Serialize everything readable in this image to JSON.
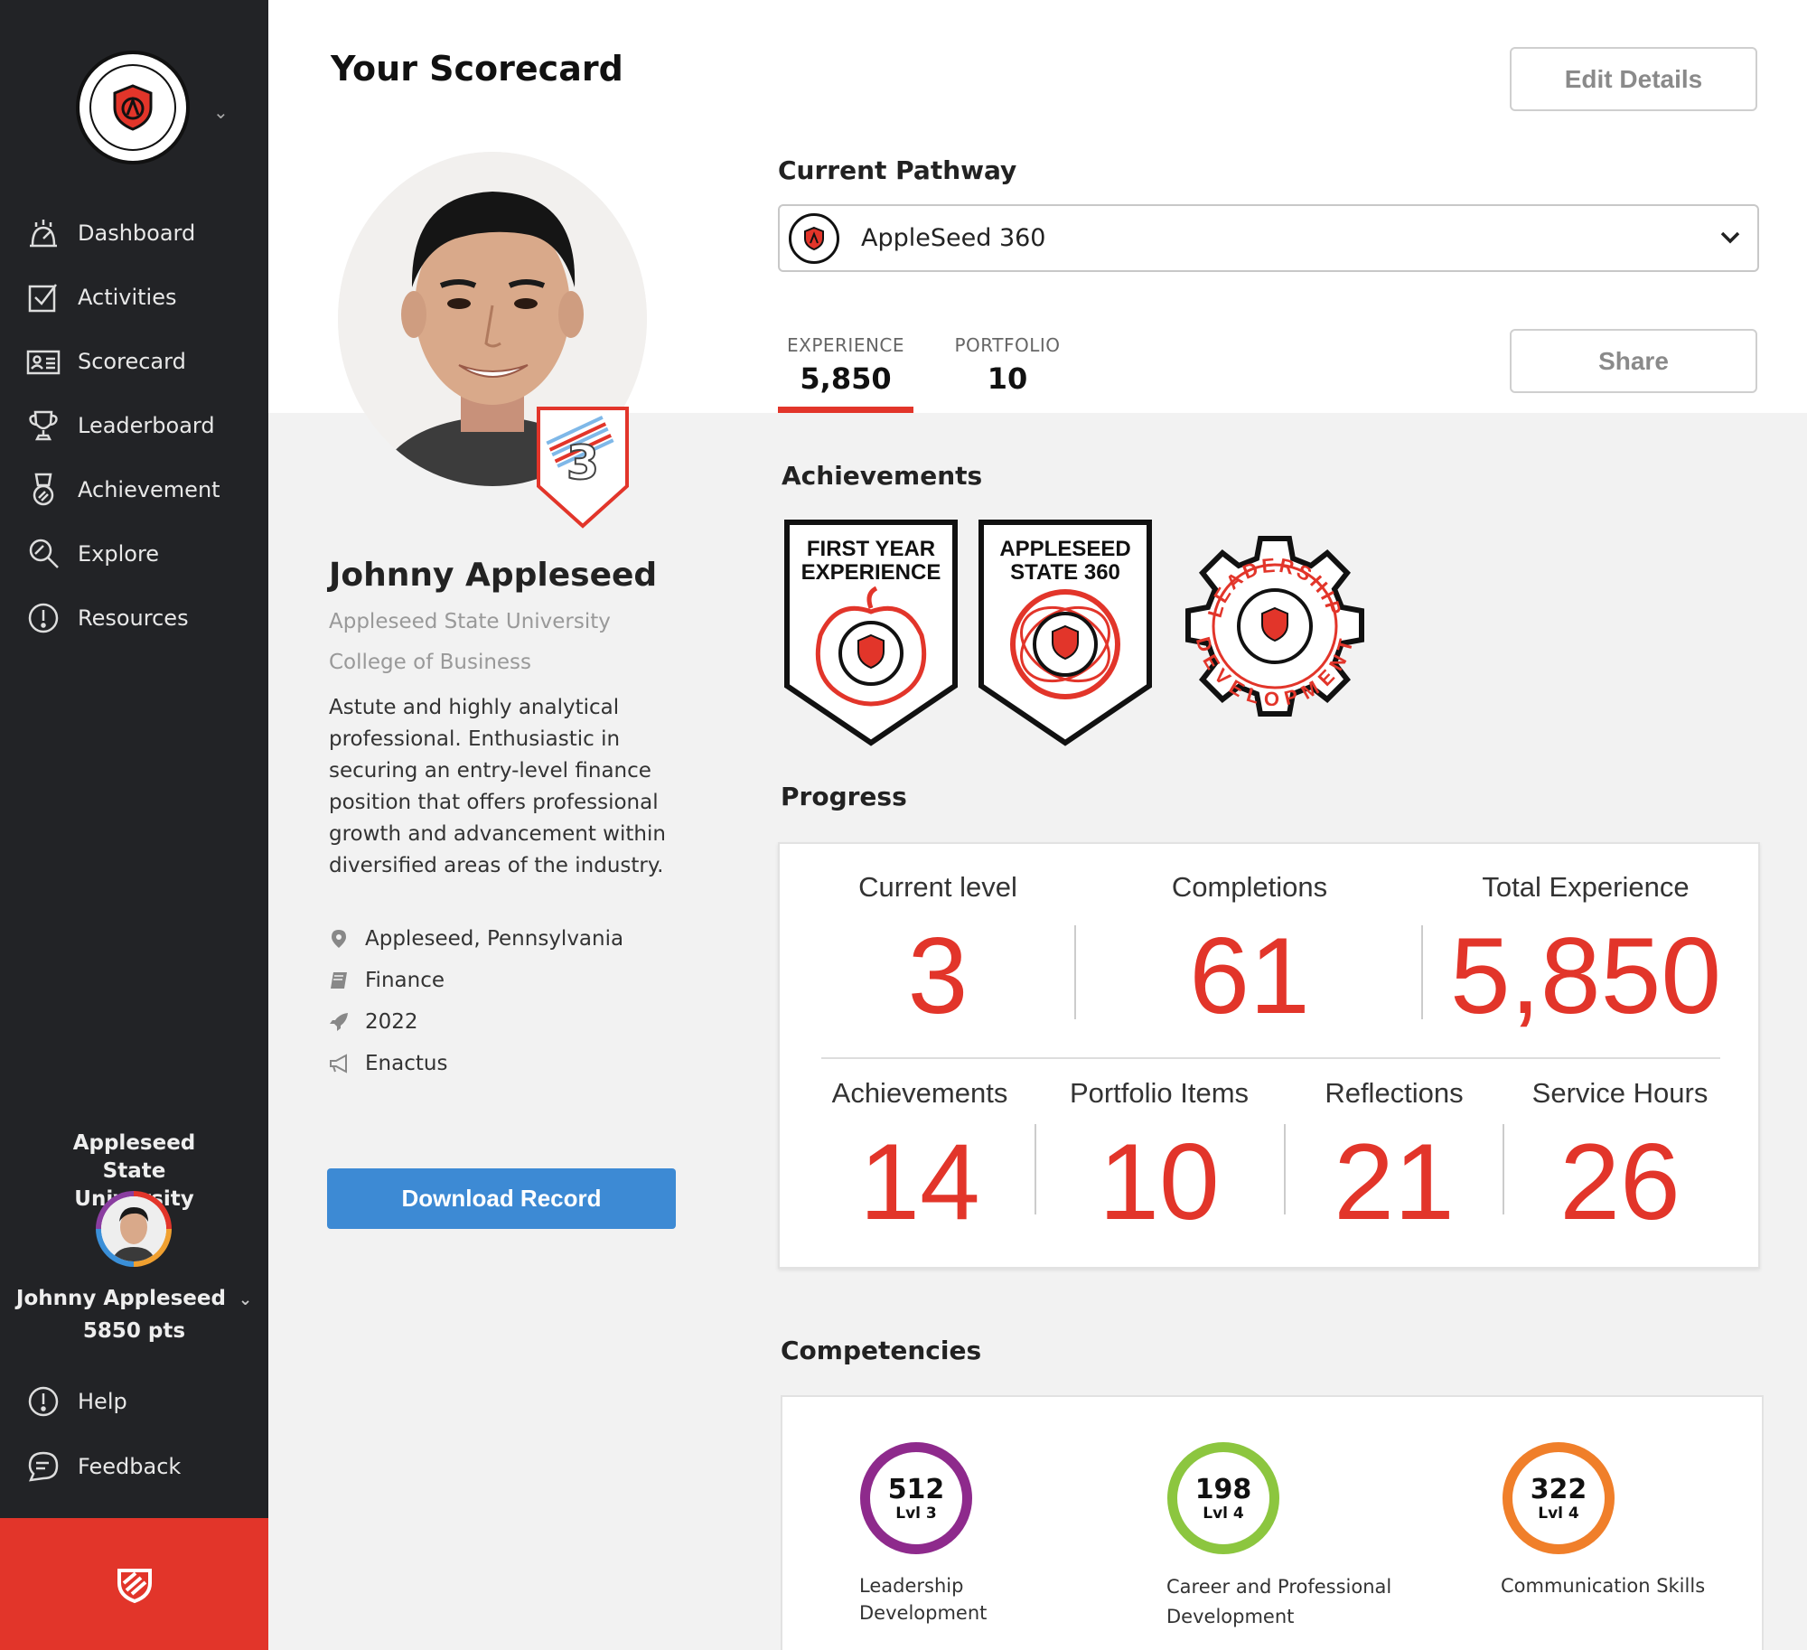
{
  "sidebar": {
    "nav": [
      {
        "label": "Dashboard",
        "icon": "dashboard-icon"
      },
      {
        "label": "Activities",
        "icon": "checkbox-icon"
      },
      {
        "label": "Scorecard",
        "icon": "id-card-icon"
      },
      {
        "label": "Leaderboard",
        "icon": "trophy-icon"
      },
      {
        "label": "Achievement",
        "icon": "medal-icon"
      },
      {
        "label": "Explore",
        "icon": "magnifier-icon"
      },
      {
        "label": "Resources",
        "icon": "info-circle-icon"
      }
    ],
    "org_name": "Appleseed State University",
    "user_name": "Johnny Appleseed",
    "points": "5850 pts",
    "help": "Help",
    "feedback": "Feedback"
  },
  "header": {
    "title": "Your Scorecard",
    "edit_button": "Edit Details",
    "share_button": "Share"
  },
  "profile": {
    "name": "Johnny Appleseed",
    "university": "Appleseed State University",
    "college": "College of Business",
    "level": "3",
    "bio": "Astute and highly analytical professional. Enthusiastic in securing an entry-level finance position that offers professional growth and advancement within diversified areas of the industry.",
    "location": "Appleseed, Pennsylvania",
    "major": "Finance",
    "year": "2022",
    "club": "Enactus",
    "download_button": "Download Record"
  },
  "pathway": {
    "title": "Current Pathway",
    "selected": "AppleSeed 360"
  },
  "tabs": [
    {
      "label": "EXPERIENCE",
      "value": "5,850"
    },
    {
      "label": "PORTFOLIO",
      "value": "10"
    }
  ],
  "achievements": {
    "title": "Achievements",
    "badges": [
      {
        "line1": "FIRST YEAR",
        "line2": "EXPERIENCE"
      },
      {
        "line1": "APPLESEED",
        "line2": "STATE 360"
      },
      {
        "line1": "LEADERSHIP",
        "line2": "DEVELOPMENT"
      }
    ]
  },
  "progress": {
    "title": "Progress",
    "top": [
      {
        "label": "Current level",
        "value": "3"
      },
      {
        "label": "Completions",
        "value": "61"
      },
      {
        "label": "Total Experience",
        "value": "5,850"
      }
    ],
    "bottom": [
      {
        "label": "Achievements",
        "value": "14"
      },
      {
        "label": "Portfolio Items",
        "value": "10"
      },
      {
        "label": "Reflections",
        "value": "21"
      },
      {
        "label": "Service Hours",
        "value": "26"
      }
    ]
  },
  "competencies": {
    "title": "Competencies",
    "items": [
      {
        "value": "512",
        "level": "Lvl 3",
        "name_line1": "Leadership",
        "name_line2": "Development",
        "color": "#8e2a8c"
      },
      {
        "value": "198",
        "level": "Lvl 4",
        "name_line1": "Career and Professional",
        "name_line2": "Development",
        "color": "#8cc63f"
      },
      {
        "value": "322",
        "level": "Lvl 4",
        "name_line1": "Communication Skills",
        "name_line2": "",
        "color": "#f07f2a"
      }
    ]
  },
  "colors": {
    "accent": "#e2352a",
    "sidebar": "#222326",
    "primary_button": "#3d8ad4"
  }
}
